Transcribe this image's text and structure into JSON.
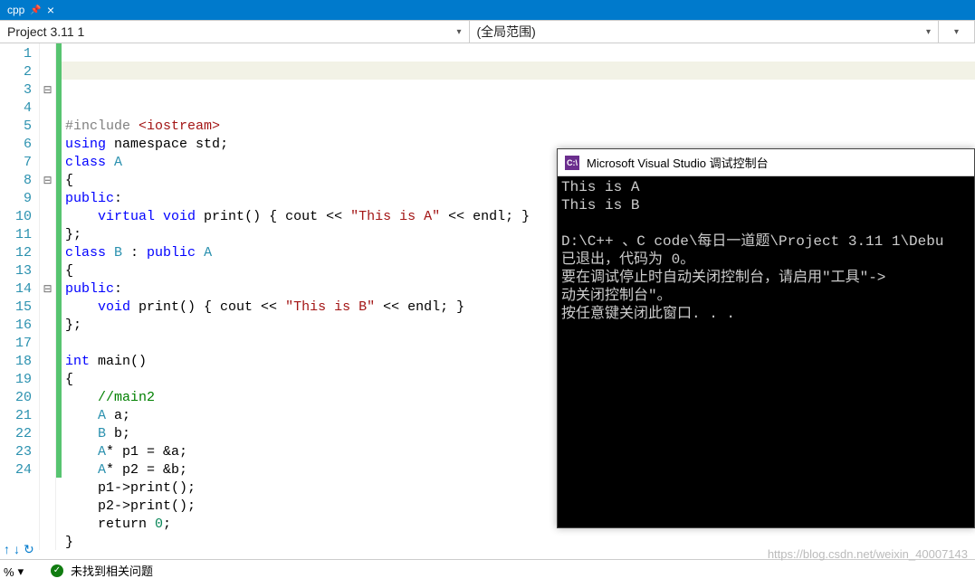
{
  "tab": {
    "label": "cpp",
    "pin_glyph": "📌",
    "close_glyph": "×"
  },
  "dropdowns": {
    "left": "Project 3.11 1",
    "right": "(全局范围)"
  },
  "line_numbers": [
    "1",
    "2",
    "3",
    "4",
    "5",
    "6",
    "7",
    "8",
    "9",
    "10",
    "11",
    "12",
    "13",
    "14",
    "15",
    "16",
    "17",
    "18",
    "19",
    "20",
    "21",
    "22",
    "23",
    "24"
  ],
  "fold_markers": [
    "",
    "",
    "",
    "⊟",
    "",
    "",
    "",
    "",
    "⊟",
    "",
    "",
    "",
    "",
    "",
    "⊟",
    "",
    "",
    "",
    "",
    "",
    "",
    "",
    "",
    "",
    ""
  ],
  "row_markers": [
    "",
    "",
    "⊟",
    "",
    "",
    "",
    "",
    "⊟",
    "",
    "",
    "",
    "",
    "",
    "⊟",
    "",
    "",
    "",
    "",
    "",
    "",
    "",
    "",
    "",
    ""
  ],
  "code": {
    "l1_a": "#include ",
    "l1_b": "<iostream>",
    "l2_a": "using",
    "l2_b": " namespace ",
    "l2_c": "std",
    "l2_d": ";",
    "l3_a": "class ",
    "l3_b": "A",
    "l4": "{",
    "l5_a": "public",
    "l5_b": ":",
    "l6_a": "    virtual",
    "l6_b": " void ",
    "l6_c": "print",
    "l6_d": "() { cout << ",
    "l6_e": "\"This is A\"",
    "l6_f": " << endl; }",
    "l7": "};",
    "l8_a": "class ",
    "l8_b": "B",
    "l8_c": " : ",
    "l8_d": "public ",
    "l8_e": "A",
    "l9": "{",
    "l10_a": "public",
    "l10_b": ":",
    "l11_a": "    void ",
    "l11_b": "print",
    "l11_c": "() { cout << ",
    "l11_d": "\"This is B\"",
    "l11_e": " << endl; }",
    "l12": "};",
    "l13": "",
    "l14_a": "int ",
    "l14_b": "main",
    "l14_c": "()",
    "l15": "{",
    "l16_a": "    ",
    "l16_b": "//main2",
    "l17_a": "    ",
    "l17_b": "A",
    "l17_c": " a;",
    "l18_a": "    ",
    "l18_b": "B",
    "l18_c": " b;",
    "l19_a": "    ",
    "l19_b": "A",
    "l19_c": "* p1 = &a;",
    "l20_a": "    ",
    "l20_b": "A",
    "l20_c": "* p2 = &b;",
    "l21": "    p1->print();",
    "l22": "    p2->print();",
    "l23_a": "    return ",
    "l23_b": "0",
    "l23_c": ";",
    "l24": "}"
  },
  "console": {
    "title": "Microsoft Visual Studio 调试控制台",
    "icon_text": "C:\\",
    "lines": [
      "This is A",
      "This is B",
      "",
      "D:\\C++ 、C code\\每日一道题\\Project 3.11 1\\Debu",
      "已退出，代码为 0。",
      "要在调试停止时自动关闭控制台，请启用\"工具\"->",
      "动关闭控制台\"。",
      "按任意键关闭此窗口. . ."
    ]
  },
  "status": {
    "text": "未找到相关问题"
  },
  "watermark": "https://blog.csdn.net/weixin_40007143",
  "zoom": "%"
}
